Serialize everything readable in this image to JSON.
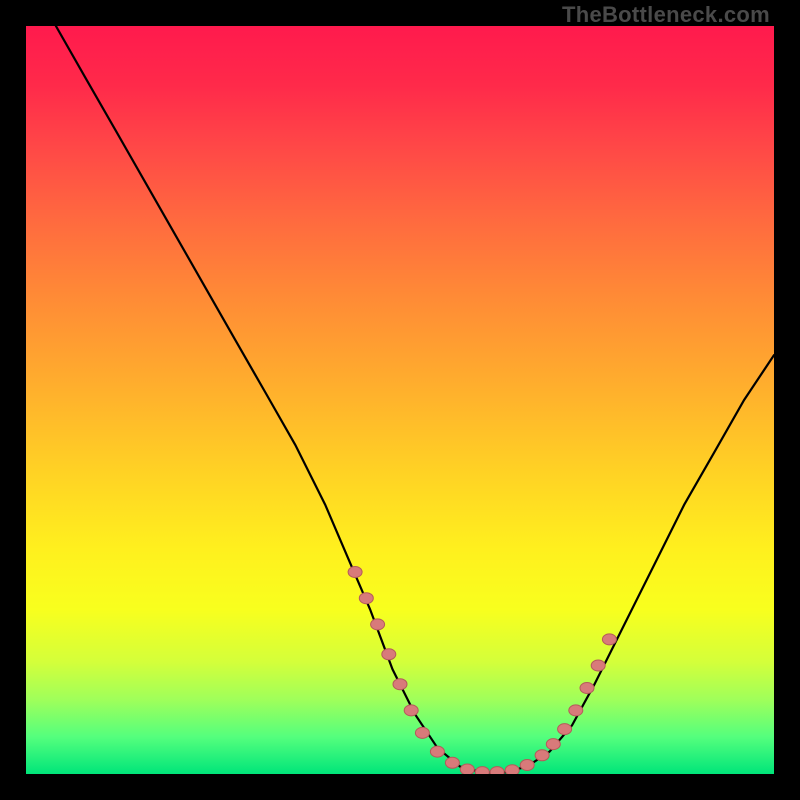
{
  "watermark": "TheBottleneck.com",
  "colors": {
    "background": "#000000",
    "gradient_top": "#ff1a4d",
    "gradient_bottom": "#00e57a",
    "curve_stroke": "#000000",
    "marker_fill": "#d87a7a",
    "marker_stroke": "#b55a5a"
  },
  "chart_data": {
    "type": "line",
    "title": "",
    "xlabel": "",
    "ylabel": "",
    "xlim": [
      0,
      100
    ],
    "ylim": [
      0,
      100
    ],
    "grid": false,
    "legend": false,
    "series": [
      {
        "name": "bottleneck-curve",
        "x": [
          4,
          8,
          12,
          16,
          20,
          24,
          28,
          32,
          36,
          40,
          43,
          46,
          49,
          52,
          55,
          58,
          61,
          64,
          67,
          70,
          73,
          76,
          80,
          84,
          88,
          92,
          96,
          100
        ],
        "y": [
          100,
          93,
          86,
          79,
          72,
          65,
          58,
          51,
          44,
          36,
          29,
          22,
          14,
          8,
          3.5,
          1.0,
          0.2,
          0.2,
          1.0,
          3.0,
          6.5,
          12,
          20,
          28,
          36,
          43,
          50,
          56
        ]
      }
    ],
    "markers": [
      {
        "x": 44,
        "y": 27
      },
      {
        "x": 45.5,
        "y": 23.5
      },
      {
        "x": 47,
        "y": 20
      },
      {
        "x": 48.5,
        "y": 16
      },
      {
        "x": 50,
        "y": 12
      },
      {
        "x": 51.5,
        "y": 8.5
      },
      {
        "x": 53,
        "y": 5.5
      },
      {
        "x": 55,
        "y": 3
      },
      {
        "x": 57,
        "y": 1.5
      },
      {
        "x": 59,
        "y": 0.6
      },
      {
        "x": 61,
        "y": 0.25
      },
      {
        "x": 63,
        "y": 0.25
      },
      {
        "x": 65,
        "y": 0.5
      },
      {
        "x": 67,
        "y": 1.2
      },
      {
        "x": 69,
        "y": 2.5
      },
      {
        "x": 70.5,
        "y": 4
      },
      {
        "x": 72,
        "y": 6
      },
      {
        "x": 73.5,
        "y": 8.5
      },
      {
        "x": 75,
        "y": 11.5
      },
      {
        "x": 76.5,
        "y": 14.5
      },
      {
        "x": 78,
        "y": 18
      }
    ]
  }
}
